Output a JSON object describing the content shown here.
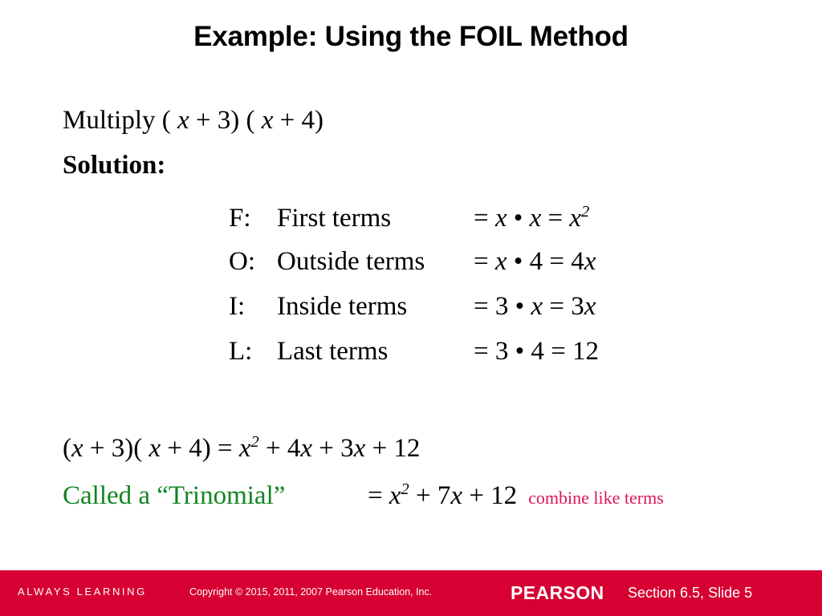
{
  "slide": {
    "title": "Example: Using the FOIL Method",
    "intro_line": "Multiply ( x + 3) ( x + 4)",
    "solution_label": "Solution:",
    "foil_rows": [
      {
        "key": "F:",
        "name": "First terms",
        "calc": "= x • x = x²"
      },
      {
        "key": "O:",
        "name": "Outside terms",
        "calc": "= x • 4 = 4x"
      },
      {
        "key": "I:",
        "name": "Inside terms",
        "calc": "= 3 • x = 3x"
      },
      {
        "key": "L:",
        "name": "Last terms",
        "calc": "= 3 • 4 = 12"
      }
    ],
    "expanded_line": "(x + 3)( x + 4) = x² + 4x + 3x + 12",
    "trinomial_label": "Called a “Trinomial”",
    "trinomial_equation": "= x² + 7x + 12",
    "combine_note": "combine like terms",
    "colors": {
      "trinomial_green": "#118522",
      "note_magenta": "#DC1659",
      "footer_red": "#D60032",
      "text_black": "#000000"
    }
  },
  "footer": {
    "tagline": "ALWAYS LEARNING",
    "copyright": "Copyright © 2015, 2011, 2007 Pearson Education, Inc.",
    "brand": "PEARSON",
    "section_slide": "Section 6.5,  Slide 5"
  }
}
